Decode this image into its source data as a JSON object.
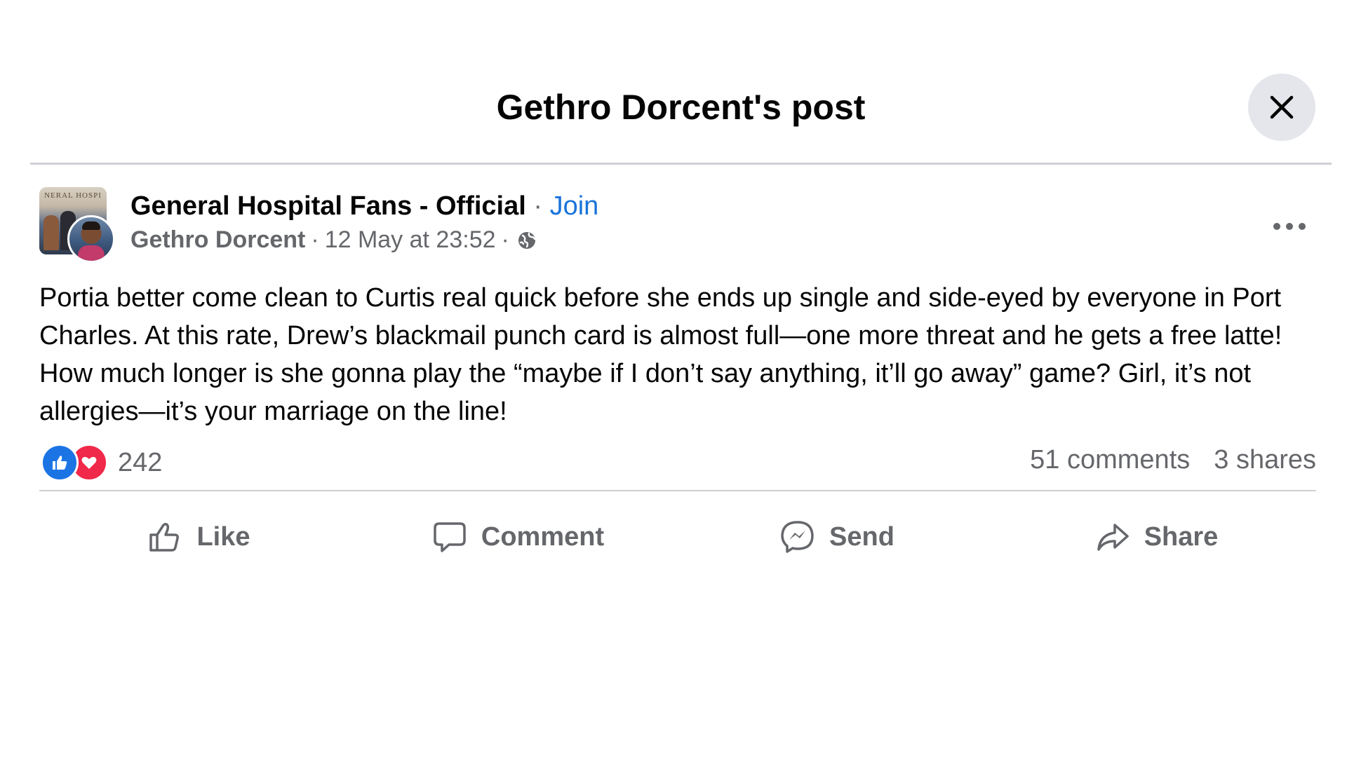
{
  "dialog": {
    "title": "Gethro Dorcent's post",
    "close_icon": "close-icon"
  },
  "post": {
    "group_avatar_text": "NERAL HOSPI",
    "group_name": "General Hospital Fans - Official",
    "separator": "·",
    "join_label": "Join",
    "author": "Gethro Dorcent",
    "timestamp": "12 May at 23:52",
    "privacy_icon": "globe-icon",
    "more_icon": "more-options-icon",
    "text": "Portia better come clean to Curtis real quick before she ends up single and side-eyed by everyone in Port Charles. At this rate, Drew’s blackmail punch card is almost full—one more threat and he gets a free latte! How much longer is she gonna play the “maybe if I don’t say anything, it’ll go away” game? Girl, it’s not allergies—it’s your marriage on the line!"
  },
  "stats": {
    "reaction_icons": [
      "like-reaction-icon",
      "love-reaction-icon"
    ],
    "reaction_count": "242",
    "comments": "51 comments",
    "shares": "3 shares"
  },
  "actions": [
    {
      "label": "Like",
      "icon": "thumbs-up-icon"
    },
    {
      "label": "Comment",
      "icon": "comment-icon"
    },
    {
      "label": "Send",
      "icon": "messenger-icon"
    },
    {
      "label": "Share",
      "icon": "share-icon"
    }
  ],
  "colors": {
    "link": "#1a73d9",
    "secondary_text": "#65676b",
    "like_blue": "#1b74e4",
    "love_red": "#f02849",
    "close_bg": "#e4e6eb"
  }
}
